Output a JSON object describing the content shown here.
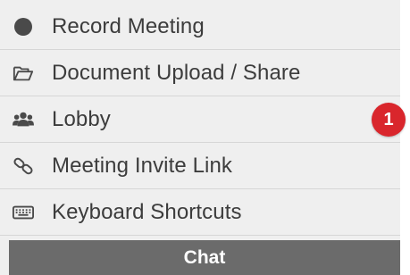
{
  "menu": {
    "items": [
      {
        "label": "Record Meeting",
        "icon": "record-dot-icon"
      },
      {
        "label": "Document Upload / Share",
        "icon": "folder-open-icon"
      },
      {
        "label": "Lobby",
        "icon": "users-icon",
        "badge": "1"
      },
      {
        "label": "Meeting Invite Link",
        "icon": "link-icon"
      },
      {
        "label": "Keyboard Shortcuts",
        "icon": "keyboard-icon"
      }
    ]
  },
  "chat": {
    "label": "Chat"
  },
  "colors": {
    "panel_bg": "#efefef",
    "text": "#3c3c3c",
    "badge": "#d9262c",
    "chat_bar": "#6b6b6b"
  }
}
